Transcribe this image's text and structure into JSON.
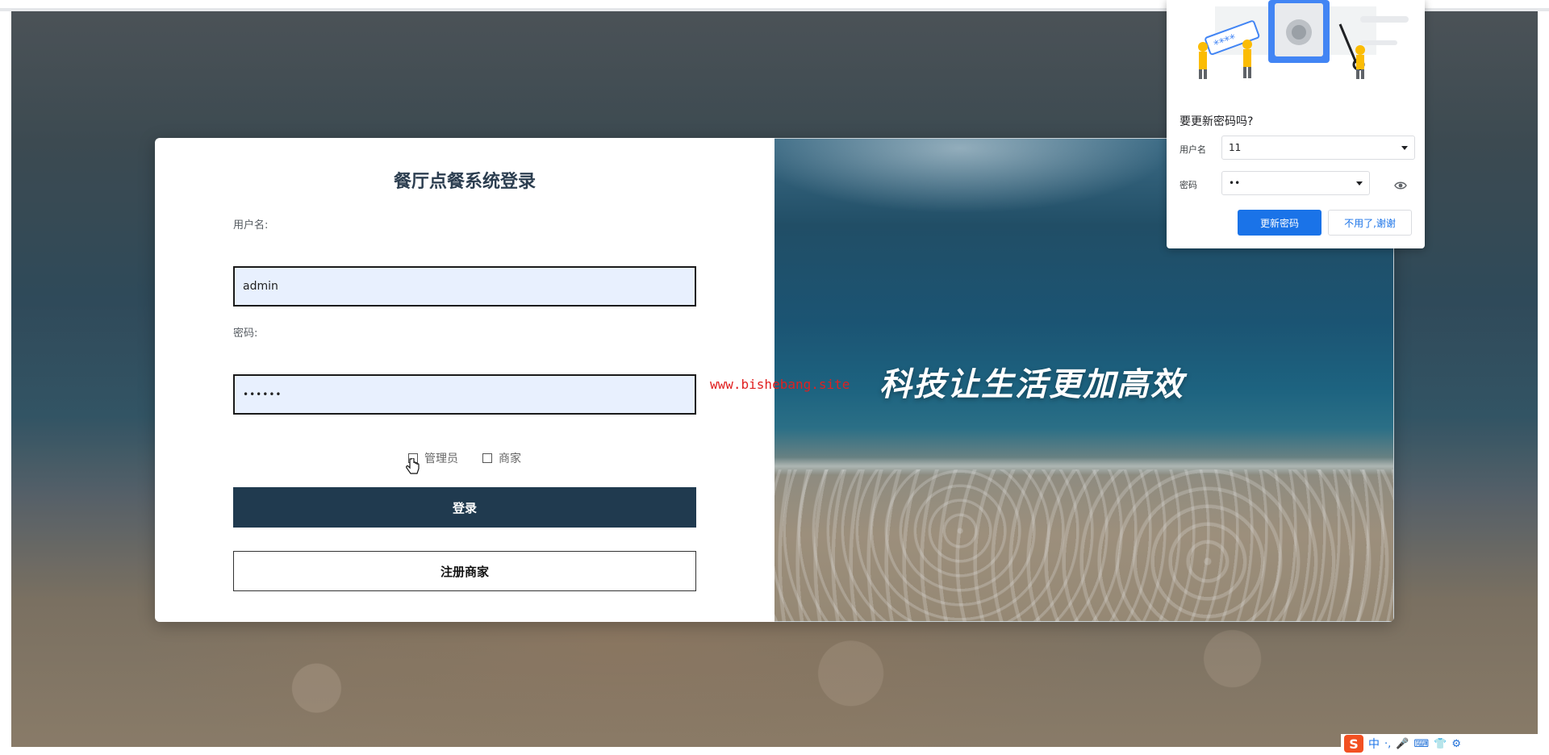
{
  "login": {
    "title": "餐厅点餐系统登录",
    "username_label": "用户名:",
    "username_value": "admin",
    "password_label": "密码:",
    "password_value": "••••••",
    "roles": [
      {
        "label": "管理员",
        "checked": false
      },
      {
        "label": "商家",
        "checked": false
      }
    ],
    "login_button": "登录",
    "register_button": "注册商家"
  },
  "hero": {
    "slogan": "科技让生活更加高效"
  },
  "watermark": "www.bishebang.site",
  "password_popup": {
    "heading": "要更新密码吗?",
    "username_label": "用户名",
    "username_value": "11",
    "password_label": "密码",
    "password_value": "••",
    "update_button": "更新密码",
    "dismiss_button": "不用了,谢谢",
    "illustration_text": "****"
  },
  "ime_toolbar": {
    "logo": "S",
    "mode": "中",
    "items": [
      "·,",
      "🎤",
      "⌨",
      "👕",
      "⚙"
    ]
  },
  "colors": {
    "primary_button": "#203a4f",
    "title_text": "#2c3e50",
    "chrome_blue": "#1a73e8",
    "watermark_red": "#e02020"
  }
}
